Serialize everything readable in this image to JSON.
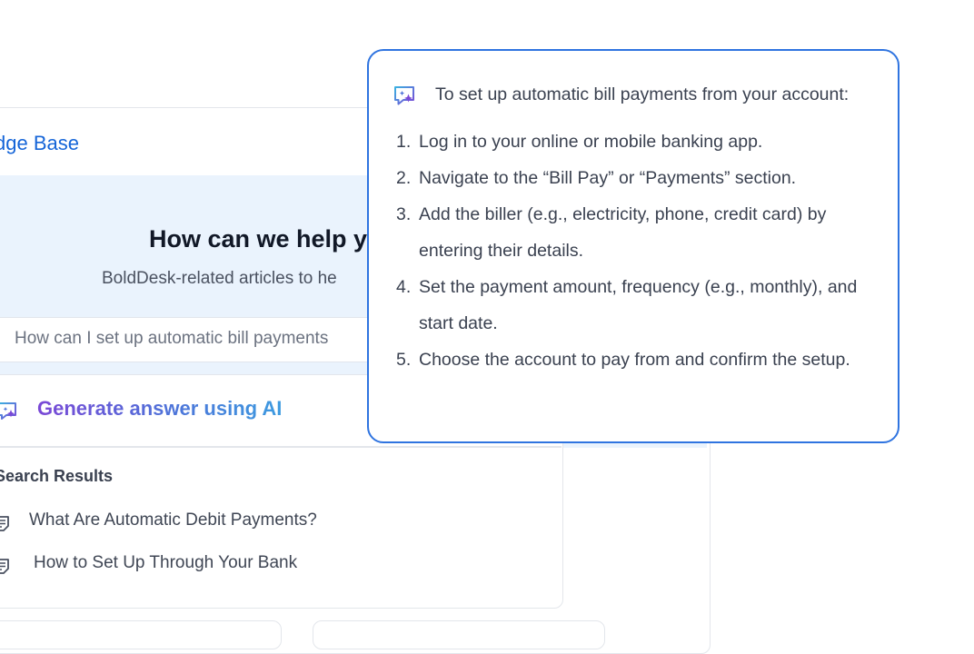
{
  "knowledge_base": {
    "title": "dge Base",
    "hero_heading": "How can we help y",
    "hero_subtitle": "BoldDesk-related articles to he",
    "search_value": "How can I set up automatic bill payments"
  },
  "ai": {
    "generate_label": "Generate answer using AI"
  },
  "results": {
    "heading": "Search Results",
    "items": [
      {
        "label": "What Are Automatic Debit Payments?"
      },
      {
        "label": "How to Set Up Through Your Bank"
      }
    ]
  },
  "popover": {
    "intro": "To set up automatic bill payments from your account:",
    "steps": [
      {
        "num": "1.",
        "text": "Log in to your online or mobile banking app."
      },
      {
        "num": "2.",
        "text": "Navigate to the “Bill Pay” or “Payments” section."
      },
      {
        "num": "3.",
        "text": "Add the biller (e.g., electricity, phone, credit card) by entering their details."
      },
      {
        "num": "4.",
        "text": "Set the payment amount, frequency (e.g., monthly), and start date."
      },
      {
        "num": "5.",
        "text": "Choose the account to pay from and confirm the setup."
      }
    ]
  },
  "colors": {
    "accent": "#2f74e0",
    "link": "#1565d8",
    "hero_bg": "#eaf3fd",
    "ai_gradient_start": "#7a48d6",
    "ai_gradient_end": "#3d9be0"
  },
  "icons": {
    "ai_sparkle": "ai-sparkle-icon",
    "document": "document-icon"
  }
}
